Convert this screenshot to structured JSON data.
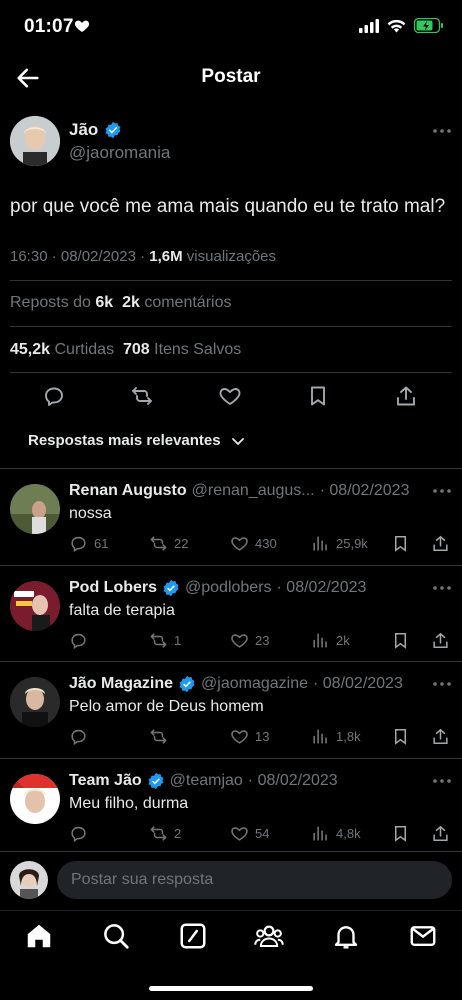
{
  "status_bar": {
    "time": "01:07"
  },
  "nav": {
    "title": "Postar"
  },
  "post": {
    "author_name": "Jão",
    "author_handle": "@jaoromania",
    "text": "por que você me ama mais quando eu te trato mal?",
    "time": "16:30 · 08/02/2023 · ",
    "views_count": "1,6M",
    "views_label": " visualizações",
    "reposts_label": "Reposts do ",
    "reposts_count": "6k",
    "comments_count": "2k",
    "comments_label": " comentários",
    "likes_count": "45,2k",
    "likes_label": " Curtidas",
    "saves_count": "708",
    "saves_label": " Itens Salvos"
  },
  "sort": {
    "label": "Respostas mais relevantes"
  },
  "replies": [
    {
      "name": "Renan Augusto",
      "handle": "@renan_augus...",
      "date": "· 08/02/2023",
      "verified": false,
      "text": "nossa",
      "comments": "61",
      "reposts": "22",
      "likes": "430",
      "views": "25,9k"
    },
    {
      "name": "Pod Lobers",
      "handle": "@podlobers",
      "date": "· 08/02/2023",
      "verified": true,
      "text": "falta de terapia",
      "comments": "",
      "reposts": "1",
      "likes": "23",
      "views": "2k"
    },
    {
      "name": "Jão Magazine",
      "handle": "@jaomagazine",
      "date": "· 08/02/2023",
      "verified": true,
      "text": "Pelo amor de Deus homem",
      "comments": "",
      "reposts": "",
      "likes": "13",
      "views": "1,8k"
    },
    {
      "name": "Team Jão",
      "handle": "@teamjao",
      "date": "· 08/02/2023",
      "verified": true,
      "text": "Meu filho, durma",
      "comments": "",
      "reposts": "2",
      "likes": "54",
      "views": "4,8k"
    }
  ],
  "compose": {
    "placeholder": "Postar sua resposta"
  },
  "colors": {
    "background": "#000000",
    "text": "#e7e9ea",
    "muted": "#71767b",
    "verified": "#1d9bf0",
    "divider": "#2f3336",
    "battery": "#34c759"
  },
  "icons": [
    "heart-icon",
    "signal-icon",
    "wifi-icon",
    "battery-icon",
    "back-arrow-icon",
    "verified-badge-icon",
    "more-icon",
    "reply-icon",
    "repost-icon",
    "like-icon",
    "bookmark-icon",
    "share-icon",
    "views-icon",
    "chevron-down-icon",
    "home-icon",
    "search-icon",
    "grok-icon",
    "communities-icon",
    "notifications-icon",
    "messages-icon"
  ]
}
